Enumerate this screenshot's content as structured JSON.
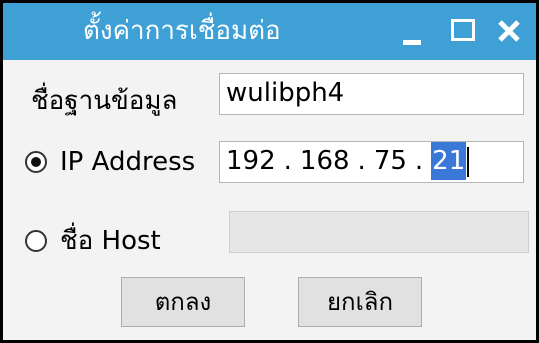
{
  "window": {
    "title": "ตั้งค่าการเชื่อมต่อ"
  },
  "form": {
    "database": {
      "label": "ชื่อฐานข้อมูล",
      "value": "wulibph4"
    },
    "ip": {
      "label": "IP Address",
      "selected": true,
      "octets": [
        "192",
        "168",
        "75",
        "21"
      ],
      "separator": "."
    },
    "host": {
      "label": "ชื่อ Host",
      "selected": false,
      "value": ""
    }
  },
  "buttons": {
    "ok_label": "ตกลง",
    "cancel_label": "ยกเลิก"
  },
  "colors": {
    "titlebar": "#3fa0d6",
    "selection": "#3a78d8"
  }
}
